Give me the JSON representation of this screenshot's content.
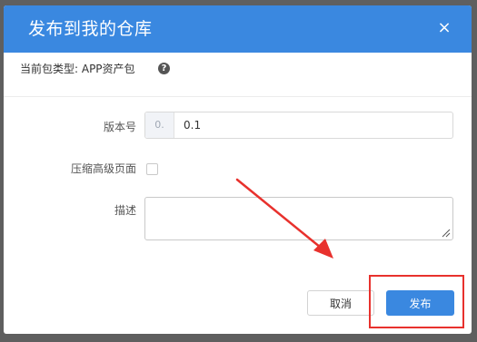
{
  "dialog": {
    "title": "发布到我的仓库",
    "close_symbol": "×",
    "package_type_text": "当前包类型: APP资产包",
    "help_symbol": "?"
  },
  "form": {
    "version_label": "版本号",
    "version_prefix": "0.",
    "version_value": "0.1",
    "compress_label": "压缩高级页面",
    "compress_checked": false,
    "description_label": "描述",
    "description_value": ""
  },
  "footer": {
    "cancel_label": "取消",
    "publish_label": "发布"
  },
  "colors": {
    "header": "#3a88e0",
    "annotation": "#e8312d"
  }
}
